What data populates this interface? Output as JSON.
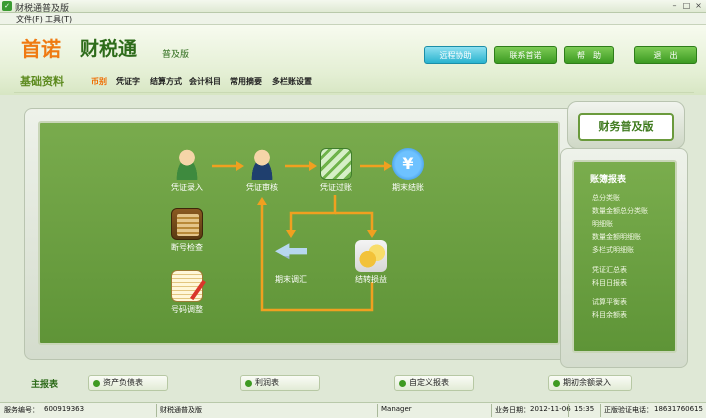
{
  "window": {
    "title": "财税通普及版"
  },
  "menu": [
    "文件(F)",
    "工具(T)"
  ],
  "header": {
    "brand_orange": "首诺",
    "brand_green": "财税通",
    "edition": "普及版",
    "buttons": [
      "远程协助",
      "联系首诺",
      "帮　助",
      "退　出"
    ],
    "section_title": "基础资料",
    "subnav": [
      "币别",
      "凭证字",
      "结算方式",
      "会计科目",
      "常用摘要",
      "多栏账设置"
    ],
    "active_subnav": "币别"
  },
  "workflow": {
    "nodes": [
      "凭证录入",
      "凭证审核",
      "凭证过账",
      "期末结账",
      "断号检查",
      "期末调汇",
      "结转损益",
      "号码调整"
    ],
    "flow_color": "#f0a020"
  },
  "right_panel": {
    "badge": "财务普及版",
    "title": "账簿报表",
    "items": [
      "总分类账",
      "数量金额总分类账",
      "明细账",
      "数量金额明细账",
      "多栏式明细账",
      "凭证汇总表",
      "科目日报表",
      "试算平衡表",
      "科目余额表"
    ]
  },
  "reports": {
    "label": "主报表",
    "buttons": [
      "资产负债表",
      "利润表",
      "自定义报表",
      "期初余额录入"
    ]
  },
  "status": {
    "service_no_label": "服务编号：",
    "service_no": "600919363",
    "product": "财税通普及版",
    "user": "Manager",
    "biz_date_label": "业务日期：",
    "biz_date": "2012-11-06",
    "time": "15:35",
    "hotline_label": "正版验证电话：",
    "hotline": "18631760615"
  },
  "colors": {
    "accent_green": "#5f9437",
    "brand_orange": "#ef7a12",
    "button_green": "#3c9a22",
    "remote_blue": "#29b3cf"
  }
}
